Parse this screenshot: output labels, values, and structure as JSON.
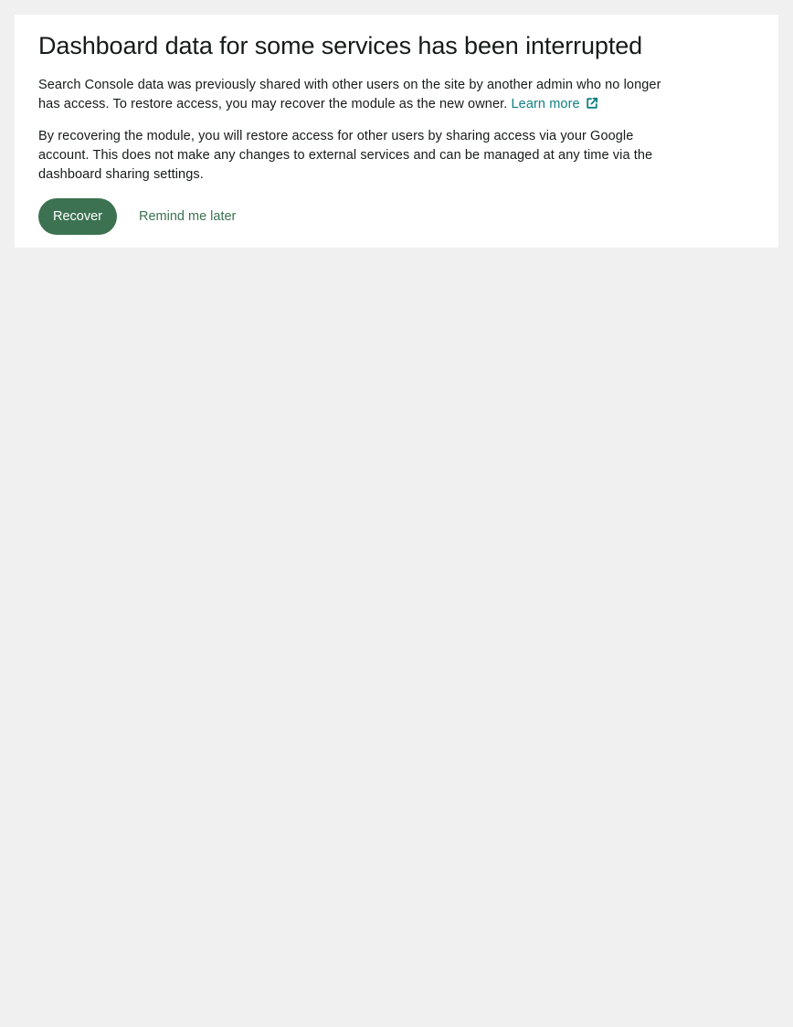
{
  "notice": {
    "title": "Dashboard data for some services has been interrupted",
    "paragraph1": "Search Console data was previously shared with other users on the site by another admin who no longer has access. To restore access, you may recover the module as the new owner.",
    "learn_more_label": "Learn more",
    "learn_more_icon": "external-link-icon",
    "paragraph2": "By recovering the module, you will restore access for other users by sharing access via your Google account. This does not make any changes to external services and can be managed at any time via the dashboard sharing settings.",
    "primary_action_label": "Recover",
    "secondary_action_label": "Remind me later"
  },
  "colors": {
    "page_background": "#f0f0f1",
    "card_background": "#ffffff",
    "primary_button": "#3c7251",
    "link": "#108080",
    "text": "#161b18"
  }
}
